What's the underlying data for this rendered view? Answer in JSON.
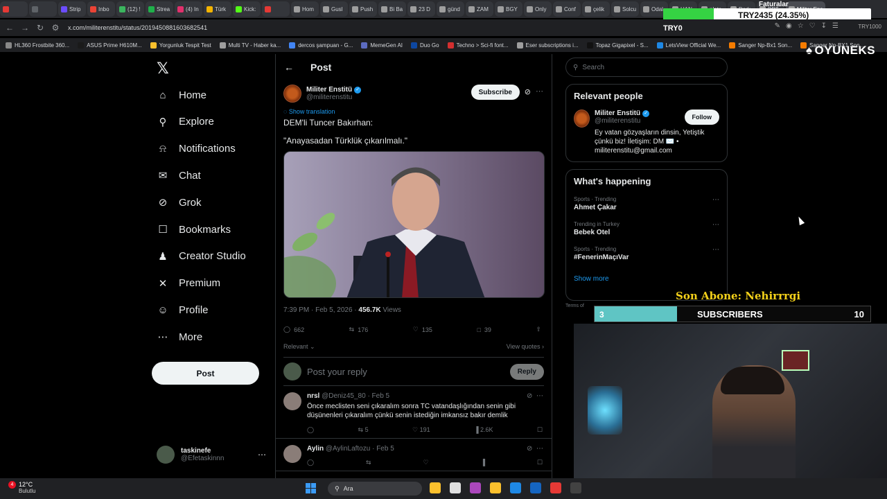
{
  "browser": {
    "tabs": [
      {
        "label": "",
        "color": "#e53935"
      },
      {
        "label": "",
        "color": "#5f6368"
      },
      {
        "label": "Strip",
        "color": "#6c4dff"
      },
      {
        "label": "Inbo",
        "color": "#ea4335"
      },
      {
        "label": "(12) !",
        "color": "#3bb55e"
      },
      {
        "label": "Strea",
        "color": "#1fb04a"
      },
      {
        "label": "(4) In",
        "color": "#e1306c"
      },
      {
        "label": "Türk",
        "color": "#f4b400"
      },
      {
        "label": "Kick:",
        "color": "#53fc18"
      },
      {
        "label": "",
        "color": "#e53935"
      },
      {
        "label": "Hom",
        "color": "#9e9e9e"
      },
      {
        "label": "Gusl",
        "color": "#9e9e9e"
      },
      {
        "label": "Push",
        "color": "#9e9e9e"
      },
      {
        "label": "Bi Ba",
        "color": "#9e9e9e"
      },
      {
        "label": "23 D",
        "color": "#9e9e9e"
      },
      {
        "label": "günd",
        "color": "#9e9e9e"
      },
      {
        "label": "ZAM",
        "color": "#9e9e9e"
      },
      {
        "label": "BGY",
        "color": "#9e9e9e"
      },
      {
        "label": "Only",
        "color": "#9e9e9e"
      },
      {
        "label": "Conf",
        "color": "#9e9e9e"
      },
      {
        "label": "çelik",
        "color": "#9e9e9e"
      },
      {
        "label": "Solcu",
        "color": "#9e9e9e"
      },
      {
        "label": "Odal",
        "color": "#9e9e9e"
      },
      {
        "label": "HAN",
        "color": "#9e9e9e"
      },
      {
        "label": "plate",
        "color": "#9e9e9e"
      },
      {
        "label": "Dark",
        "color": "#9e9e9e"
      },
      {
        "label": "BPT",
        "color": "#9e9e9e"
      },
      {
        "label": "Militer Ens",
        "color": "#9e9e9e"
      }
    ],
    "faturalar_label": "Faturalar",
    "counter_text": "TRY2435 (24.35%)",
    "counter_fraction": 0.2435,
    "try0_label": "TRY0",
    "try1000_label": "TRY1000",
    "url": "x.com/militerenstitu/status/2019450881603682541",
    "bookmarks": [
      {
        "label": "HL360 Frostbite 360...",
        "color": "#888"
      },
      {
        "label": "ASUS Prime H610M...",
        "color": "#1a1a1a"
      },
      {
        "label": "Yorgunluk Tespit Test",
        "color": "#fbc02d"
      },
      {
        "label": "Multi TV - Haber ka...",
        "color": "#9e9e9e"
      },
      {
        "label": "dercos şampuan - G...",
        "color": "#4285f4"
      },
      {
        "label": "MemeGen AI",
        "color": "#5c6bc0"
      },
      {
        "label": "Duo Go",
        "color": "#0d47a1"
      },
      {
        "label": "Techno > Sci-fi font...",
        "color": "#d32f2f"
      },
      {
        "label": "Eser subscriptions i...",
        "color": "#9e9e9e"
      },
      {
        "label": "Topaz Gigapixel - S...",
        "color": "#111"
      },
      {
        "label": "LetsView Official We...",
        "color": "#1e88e5"
      },
      {
        "label": "Sanger Np-Bx1 Son...",
        "color": "#f57c00"
      },
      {
        "label": "Sanger Np-BX1 Son...",
        "color": "#f57c00"
      }
    ]
  },
  "nav": {
    "items": [
      {
        "label": "Home",
        "icon": "home-icon"
      },
      {
        "label": "Explore",
        "icon": "search-icon"
      },
      {
        "label": "Notifications",
        "icon": "bell-icon"
      },
      {
        "label": "Chat",
        "icon": "mail-icon"
      },
      {
        "label": "Grok",
        "icon": "grok-icon"
      },
      {
        "label": "Bookmarks",
        "icon": "bookmark-icon"
      },
      {
        "label": "Creator Studio",
        "icon": "creator-icon"
      },
      {
        "label": "Premium",
        "icon": "x-icon"
      },
      {
        "label": "Profile",
        "icon": "person-icon"
      },
      {
        "label": "More",
        "icon": "more-icon"
      }
    ],
    "post_button": "Post",
    "user_name": "taskinefe",
    "user_handle": "@Efetaskinnn"
  },
  "main": {
    "header_title": "Post",
    "author_name": "Militer Enstitü",
    "author_handle": "@militerenstitu",
    "subscribe": "Subscribe",
    "show_translation": "Show translation",
    "text_line1": "DEM'li Tuncer Bakırhan:",
    "text_line2": "\"Anayasadan Türklük çıkarılmalı.\"",
    "time": "7:39 PM · Feb 5, 2026 · ",
    "views_count": "456.7K",
    "views_label": " Views",
    "replies": "662",
    "reposts": "176",
    "likes": "135",
    "bookmarks": "39",
    "relevant": "Relevant",
    "view_quotes": "View quotes",
    "reply_placeholder": "Post your reply",
    "reply_button": "Reply",
    "reply_items": [
      {
        "name": "nrsl",
        "handle": "@Deniz45_80",
        "date": "· Feb 5",
        "text": "Önce meclisten seni çıkaralım sonra TC vatandaşlığından senin gibi düşünenleri çıkaralım  çünkü senin istediğin imkansız bakır demlik",
        "reposts": "5",
        "likes": "191",
        "views": "2.6K"
      },
      {
        "name": "Aylin",
        "handle": "@AylinLaftozu",
        "date": "· Feb 5",
        "text": "",
        "reposts": "",
        "likes": "",
        "views": ""
      }
    ]
  },
  "right": {
    "search_placeholder": "Search",
    "relevant_title": "Relevant people",
    "person_name": "Militer Enstitü",
    "person_handle": "@militerenstitu",
    "person_bio": "Ey vatan gözyaşların dinsin, Yetiştik çünkü biz! İletişim: DM ✉️ • militerenstitu@gmail.com",
    "follow": "Follow",
    "happening_title": "What's happening",
    "trends": [
      {
        "category": "Sports · Trending",
        "name": "Ahmet Çakar"
      },
      {
        "category": "Trending in Turkey",
        "name": "Bebek Otel"
      },
      {
        "category": "Sports · Trending",
        "name": "#FenerinMaçıVar"
      }
    ],
    "show_more": "Show more",
    "terms": "Terms of"
  },
  "overlay": {
    "brand": "OYUNEKS",
    "son_abone": "Son Abone: Nehirrrgi",
    "sub_current": "3",
    "sub_label": "SUBSCRIBERS",
    "sub_goal": "10",
    "sub_fraction": 0.3
  },
  "taskbar": {
    "badge": "4",
    "temp": "12°C",
    "weather": "Bulutlu",
    "search": "Ara",
    "icons": [
      {
        "name": "file-icon",
        "color": "#fbc02d"
      },
      {
        "name": "taskview-icon",
        "color": "#e0e0e0"
      },
      {
        "name": "copilot-icon",
        "color": "#ab47bc"
      },
      {
        "name": "folder-icon",
        "color": "#fbc02d"
      },
      {
        "name": "edge-icon",
        "color": "#1e88e5"
      },
      {
        "name": "store-icon",
        "color": "#1565c0"
      },
      {
        "name": "opera-icon",
        "color": "#e53935"
      },
      {
        "name": "app-icon",
        "color": "#424242"
      }
    ]
  }
}
